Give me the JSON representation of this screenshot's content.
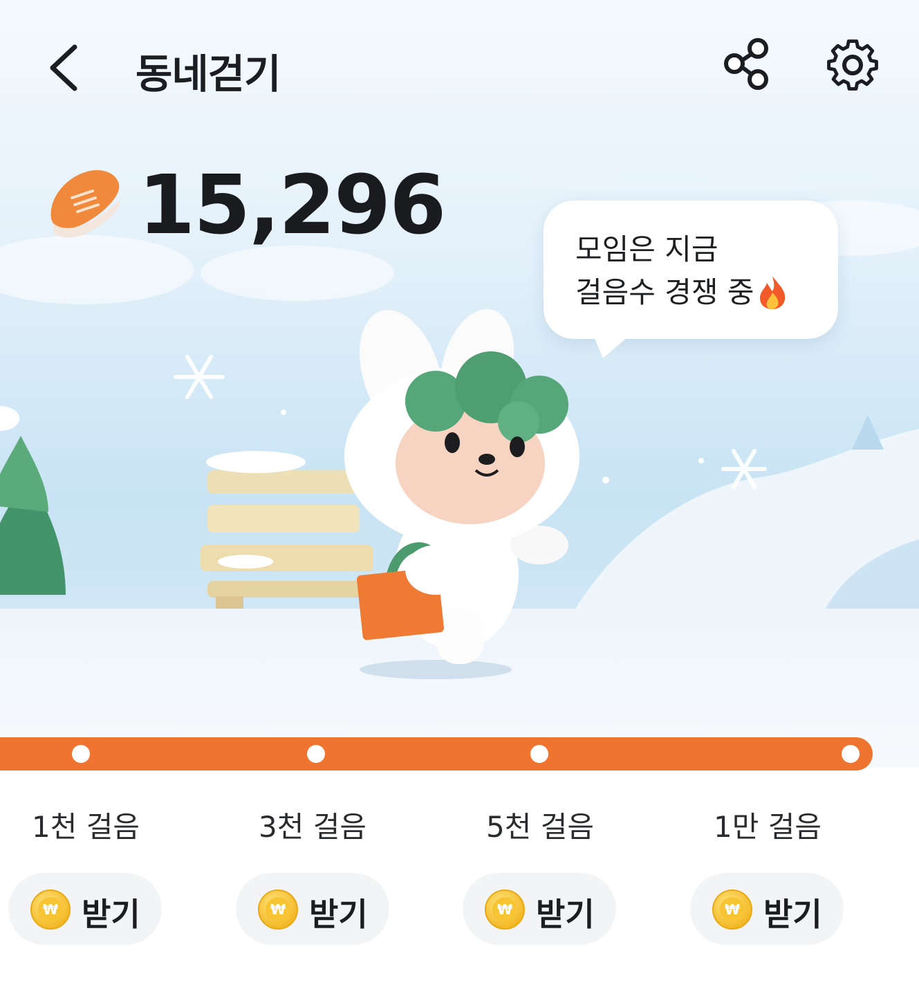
{
  "header": {
    "title": "동네걷기"
  },
  "steps": {
    "count": "15,296"
  },
  "bubble": {
    "line1": "모임은 지금",
    "line2": "걸음수 경쟁 중"
  },
  "progress": {
    "current_fraction": 1.0
  },
  "milestones": [
    {
      "label": "1천 걸음",
      "button": "받기"
    },
    {
      "label": "3천 걸음",
      "button": "받기"
    },
    {
      "label": "5천 걸음",
      "button": "받기"
    },
    {
      "label": "1만 걸음",
      "button": "받기"
    }
  ],
  "icons": {
    "back": "chevron-left-icon",
    "share": "share-icon",
    "settings": "gear-icon",
    "shoe": "sneaker-icon",
    "fire": "fire-icon",
    "coin": "won-coin-icon"
  },
  "colors": {
    "accent": "#ef7430",
    "sky": "#d6ebf8",
    "snow": "#f3f8fc",
    "tree": "#4da06c",
    "coin": "#f7c534"
  }
}
